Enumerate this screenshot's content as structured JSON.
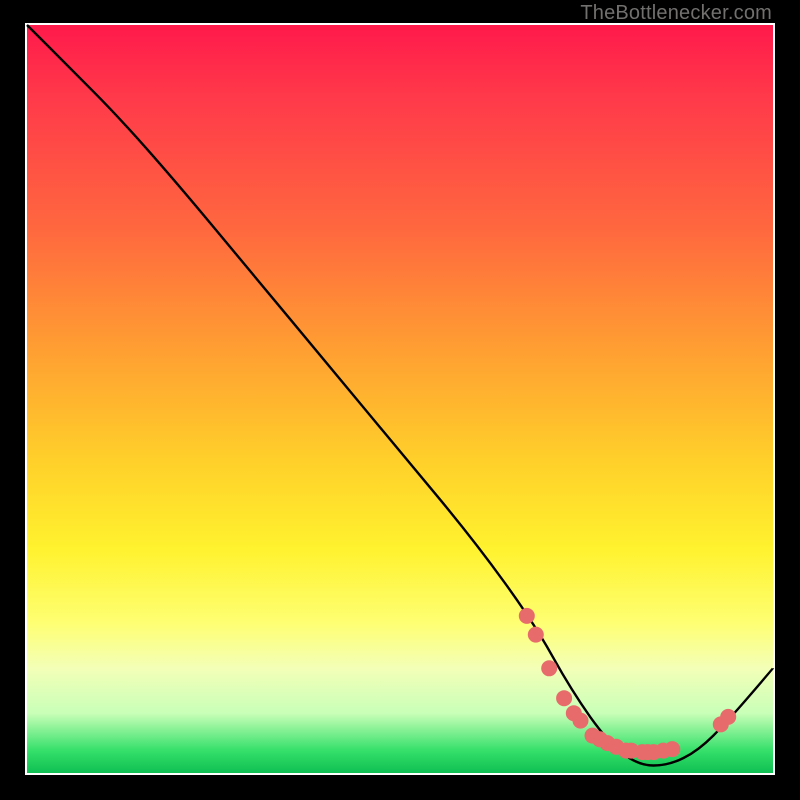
{
  "watermark": {
    "text": "TheBottlenecker.com"
  },
  "chart_data": {
    "type": "line",
    "title": "",
    "xlabel": "",
    "ylabel": "",
    "xlim": [
      0,
      100
    ],
    "ylim": [
      0,
      100
    ],
    "series": [
      {
        "name": "curve",
        "color": "#000000",
        "x": [
          0,
          6,
          12,
          20,
          30,
          40,
          50,
          60,
          68,
          73,
          78,
          82,
          86,
          90,
          94,
          100
        ],
        "y": [
          100,
          94,
          88,
          79,
          67,
          55,
          43,
          31,
          20,
          11,
          4,
          1,
          1,
          3,
          7,
          14
        ]
      }
    ],
    "markers": {
      "name": "dots",
      "color": "#e86b6b",
      "radius": 8,
      "x": [
        67.0,
        68.2,
        70.0,
        72.0,
        73.3,
        74.2,
        75.8,
        76.8,
        77.8,
        79.0,
        80.3,
        81.0,
        82.5,
        83.2,
        84.0,
        85.3,
        86.5,
        93.0,
        94.0
      ],
      "y": [
        21.0,
        18.5,
        14.0,
        10.0,
        8.0,
        7.0,
        5.0,
        4.5,
        4.0,
        3.5,
        3.0,
        3.0,
        2.8,
        2.8,
        2.8,
        3.0,
        3.2,
        6.5,
        7.5
      ]
    }
  }
}
